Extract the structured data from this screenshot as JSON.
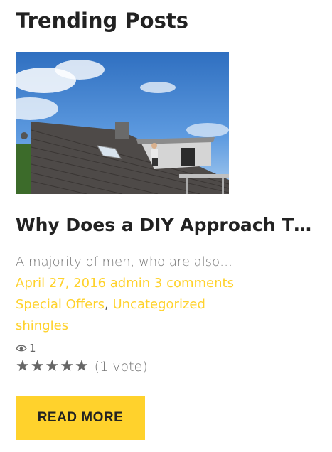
{
  "widget": {
    "title": "Trending Posts"
  },
  "post": {
    "title": "Why Does a DIY Approach T…",
    "excerpt": "A majority of men, who are also…",
    "date": "April 27, 2016",
    "author": "admin",
    "comments": "3 comments",
    "categories": [
      "Special Offers",
      "Uncategorized"
    ],
    "category_separator": ",",
    "tags": [
      "shingles"
    ],
    "views": "1",
    "rating": {
      "stars": 5,
      "max_stars": 5,
      "vote_text": "(1 vote)"
    },
    "read_more_label": "READ MORE"
  },
  "colors": {
    "accent": "#ffd22c",
    "heading": "#222222",
    "muted": "#777777",
    "star": "#666666"
  },
  "icons": {
    "views": "eye-icon",
    "rating": "star-icon"
  }
}
